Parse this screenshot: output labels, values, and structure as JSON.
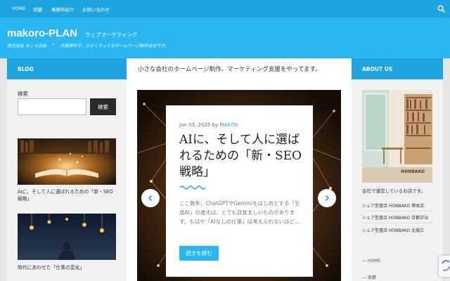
{
  "top_nav": {
    "items": [
      "HOME",
      "実績",
      "事務所紹介",
      "お問い合わせ"
    ]
  },
  "header": {
    "site_title": "makoro-PLAN",
    "tagline": "ウェブマーケティング",
    "breadcrumb": [
      "株式会社 まころ企画",
      "»",
      "大阪堺市で、小さくやってるホームページ制作会社です。"
    ]
  },
  "left_sidebar": {
    "title": "BLOG",
    "search_label": "検索",
    "search_placeholder": "",
    "search_button": "検索",
    "posts": [
      {
        "title": "AIに、そして人に選ばれるための「新・SEO戦略」"
      },
      {
        "title": "時代にあわせた「仕事の変化」"
      }
    ]
  },
  "main": {
    "intro": "小さな会社のホームページ制作、マーケティング支援をやってます。",
    "featured": {
      "date": "Jun 03, 2025",
      "by": "by",
      "author": "MAKITA",
      "title": "AIに、そして人に選ばれるための「新・SEO戦略」",
      "excerpt": "ここ数年、ChatGPTやGeminiをはじめとする「生成AI」の進化は、とても目覚ましいものがあります。もはや「AIなしの仕事」は考えられないほど…",
      "read_more": "続きを読む"
    }
  },
  "right_sidebar": {
    "title": "ABOUT US",
    "image_caption": "HONBAKO",
    "description": "会社で運営しているお店です。",
    "stores": [
      "シェア型書店 HONBAKO 堺本店",
      "シェア型書店 HONBAKO 京都宇治",
      "シェア型書店 HONBAKO 北堀江"
    ],
    "nav": [
      "HOME",
      "実績"
    ]
  },
  "colors": {
    "top_nav": "#1ea4df",
    "header": "#29b6f1",
    "button_dark": "#2b2b2b",
    "accent": "#1ea4df"
  }
}
